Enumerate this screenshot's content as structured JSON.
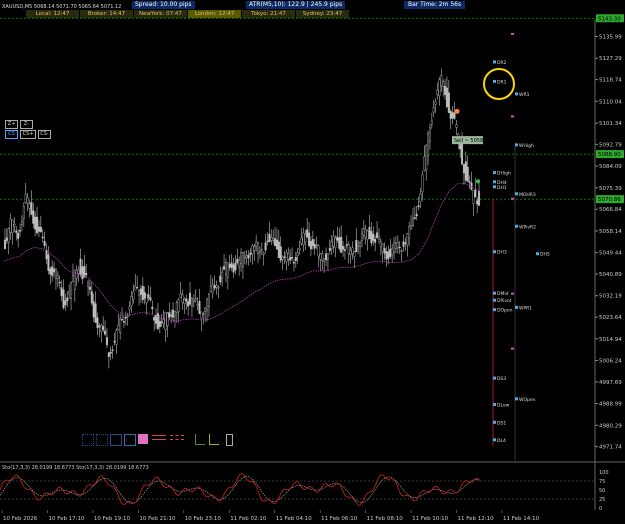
{
  "symbol_line": "XAUUSD,M5  5068.14 5071.70 5065.64 5071.12",
  "info_bar": {
    "spread": "Spread: 10.00 pips",
    "atr": "ATR(M5,10): 122.9  |  245.9 pips",
    "bar_time": "Bar Time: 2m 56s"
  },
  "sessions": [
    {
      "label": "Local: 12:47",
      "color": "#2a2a10"
    },
    {
      "label": "Broker: 14:47",
      "color": "#2a2a10"
    },
    {
      "label": "NewYork: 07:47",
      "color": "#2a2a10"
    },
    {
      "label": "London: 12:47",
      "color": "#5a5a00"
    },
    {
      "label": "Tokyo: 21:47",
      "color": "#2a2a10"
    },
    {
      "label": "Sydney: 23:47",
      "color": "#2a2a10"
    }
  ],
  "buttons": [
    "Z+",
    "Z-",
    "CS",
    "CS+",
    "CS-"
  ],
  "colors": {
    "bull": "#c0c0c0",
    "bear": "#c0c0c0",
    "ma": "#b040b0",
    "level_green": "#00aa00",
    "highlight_ring": "#ffd700",
    "stoch_main": "#cc2222",
    "stoch_signal": "#bbbbbb"
  },
  "chart_data": {
    "type": "candlestick",
    "symbol": "XAUUSD",
    "timeframe": "M5",
    "ohlc_last": {
      "open": 5068.14,
      "high": 5071.7,
      "low": 5065.64,
      "close": 5071.12
    },
    "ylim": [
      4966.0,
      5143.0
    ],
    "y_ticks": [
      "5135.99",
      "5127.29",
      "5118.74",
      "5110.04",
      "5101.34",
      "5092.79",
      "5084.09",
      "5075.39",
      "5066.84",
      "5058.14",
      "5049.44",
      "5040.89",
      "5032.19",
      "5023.64",
      "5014.94",
      "5006.24",
      "4997.69",
      "4988.99",
      "4980.29",
      "4971.74"
    ],
    "x_ticks": [
      "10 Feb 2026",
      "10 Feb 17:10",
      "10 Feb 19:10",
      "10 Feb 21:10",
      "10 Feb 23:10",
      "11 Feb 02:10",
      "11 Feb 04:10",
      "11 Feb 06:10",
      "11 Feb 08:10",
      "11 Feb 10:10",
      "11 Feb 12:10",
      "11 Feb 14:10"
    ],
    "close_series": [
      5052,
      5060,
      5058,
      5070,
      5064,
      5055,
      5045,
      5040,
      5030,
      5035,
      5045,
      5038,
      5026,
      5018,
      5010,
      5016,
      5024,
      5030,
      5036,
      5031,
      5024,
      5020,
      5025,
      5028,
      5032,
      5030,
      5026,
      5030,
      5036,
      5041,
      5044,
      5045,
      5048,
      5052,
      5050,
      5054,
      5052,
      5048,
      5046,
      5050,
      5056,
      5053,
      5048,
      5050,
      5054,
      5052,
      5049,
      5054,
      5057,
      5056,
      5052,
      5049,
      5051,
      5054,
      5058,
      5070,
      5090,
      5110,
      5118,
      5108,
      5098,
      5084,
      5072,
      5071.12
    ],
    "price_levels": [
      {
        "label": "5143.30",
        "value": 5143.3,
        "color": "#00aa00",
        "style": "dotted"
      },
      {
        "label": "5088.90",
        "value": 5088.9,
        "color": "#00aa00",
        "style": "dotted"
      },
      {
        "label": "5070.86",
        "value": 5070.86,
        "color": "#00aa00",
        "style": "dotted"
      }
    ],
    "annotations": [
      {
        "text": "DR2",
        "value": 5125.8,
        "color": "#dddddd"
      },
      {
        "text": "DR1",
        "value": 5118.0,
        "color": "#dddddd"
      },
      {
        "text": "WR1",
        "value": 5113.0,
        "color": "#dddddd"
      },
      {
        "text": "WHigh",
        "value": 5092.6,
        "color": "#dddddd"
      },
      {
        "text": "DHigh",
        "value": 5081.5,
        "color": "#dddddd"
      },
      {
        "text": "DH4",
        "value": 5077.8,
        "color": "#dddddd"
      },
      {
        "text": "DH1",
        "value": 5075.8,
        "color": "#dddddd"
      },
      {
        "text": "MOHR3",
        "value": 5073.0,
        "color": "#dddddd"
      },
      {
        "text": "WPivR2",
        "value": 5060.0,
        "color": "#dddddd"
      },
      {
        "text": "DH3",
        "value": 5049.8,
        "color": "#dddddd"
      },
      {
        "text": "DH5",
        "value": 5049.0,
        "color": "#dddddd"
      },
      {
        "text": "DMid",
        "value": 5033.2,
        "color": "#dddddd"
      },
      {
        "text": "DPivot",
        "value": 5030.4,
        "color": "#dddddd"
      },
      {
        "text": "WPR1",
        "value": 5027.5,
        "color": "#dddddd"
      },
      {
        "text": "DOpen",
        "value": 5026.6,
        "color": "#dddddd"
      },
      {
        "text": "DS3",
        "value": 4999.2,
        "color": "#dddddd"
      },
      {
        "text": "WOpen",
        "value": 4990.9,
        "color": "#dddddd"
      },
      {
        "text": "DLow",
        "value": 4988.6,
        "color": "#dddddd"
      },
      {
        "text": "DS1",
        "value": 4981.5,
        "color": "#dddddd"
      },
      {
        "text": "DL4",
        "value": 4974.5,
        "color": "#dddddd"
      }
    ],
    "sell_tag": "Sell ~ 5058",
    "subchart": {
      "label": "Sto(17,3,3) 28.0199 18.6773  Sto(17,3,3) 28.0199 18.6773",
      "ylim": [
        0,
        100
      ],
      "y_ticks": [
        "100",
        "75",
        "50",
        "25",
        "0"
      ]
    }
  }
}
